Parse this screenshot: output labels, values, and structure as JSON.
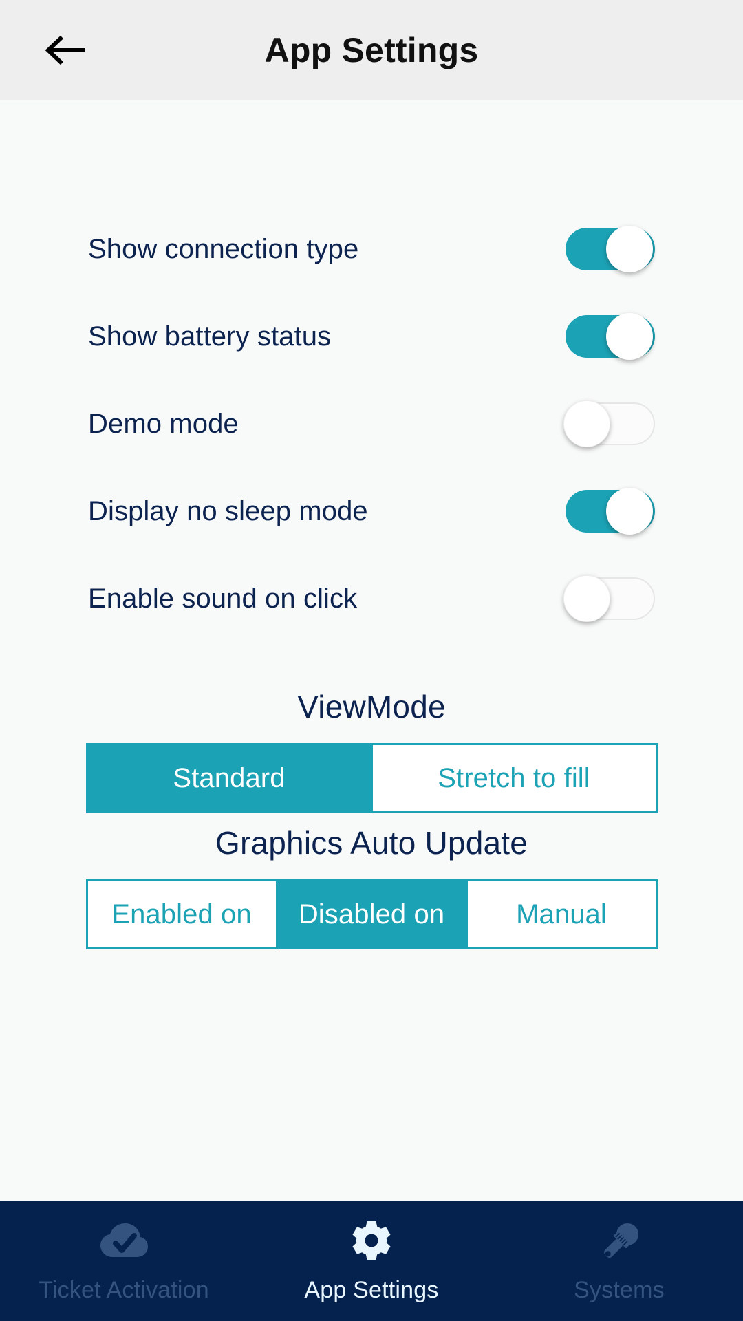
{
  "header": {
    "title": "App Settings",
    "back_icon": "arrow-left-icon"
  },
  "colors": {
    "accent_teal": "#1ba2b4",
    "navy_text": "#0c2350",
    "nav_bar_bg": "#05224e",
    "nav_inactive": "#34537f",
    "nav_active": "#eaf6fd",
    "header_bg": "#eeeeee",
    "page_bg": "#f8f9f9"
  },
  "settings": {
    "toggles": [
      {
        "label": "Show connection type",
        "state": "on"
      },
      {
        "label": "Show battery status",
        "state": "on"
      },
      {
        "label": "Demo mode",
        "state": "off"
      },
      {
        "label": "Display no sleep mode",
        "state": "on"
      },
      {
        "label": "Enable sound on click",
        "state": "off"
      }
    ]
  },
  "view_mode": {
    "title": "ViewMode",
    "options": [
      {
        "label": "Standard",
        "selected": true
      },
      {
        "label": "Stretch to fill",
        "selected": false
      }
    ]
  },
  "graphics_auto_update": {
    "title": "Graphics Auto Update",
    "options": [
      {
        "label": "Enabled on",
        "selected": false
      },
      {
        "label": "Disabled on",
        "selected": true
      },
      {
        "label": "Manual",
        "selected": false
      }
    ]
  },
  "bottom_nav": {
    "items": [
      {
        "label": "Ticket Activation",
        "icon": "cloud-check-icon",
        "active": false
      },
      {
        "label": "App Settings",
        "icon": "gear-icon",
        "active": true
      },
      {
        "label": "Systems",
        "icon": "wrench-icon",
        "active": false
      }
    ]
  }
}
